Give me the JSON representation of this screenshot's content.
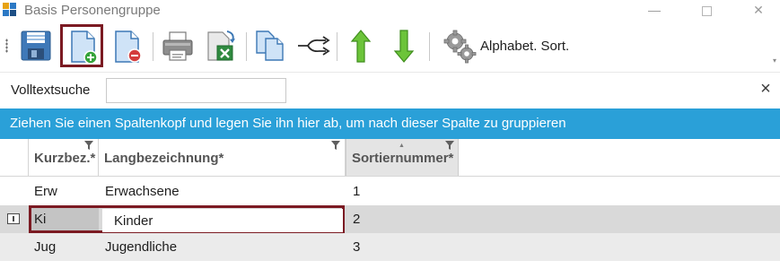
{
  "window": {
    "title": "Basis Personengruppe",
    "minimize_glyph": "—",
    "close_glyph": "✕"
  },
  "toolbar": {
    "buttons": [
      {
        "name": "save",
        "icon": "floppy-disk-icon",
        "active": false
      },
      {
        "name": "new-record",
        "icon": "document-add-icon",
        "active": true
      },
      {
        "name": "delete-record",
        "icon": "document-remove-icon",
        "active": false
      },
      {
        "name": "print",
        "icon": "printer-icon",
        "active": false
      },
      {
        "name": "export-excel",
        "icon": "excel-export-icon",
        "active": false
      },
      {
        "name": "copy",
        "icon": "copy-document-icon",
        "active": false
      },
      {
        "name": "flow",
        "icon": "flow-arrows-icon",
        "active": false
      },
      {
        "name": "move-up",
        "icon": "arrow-up-icon",
        "active": false
      },
      {
        "name": "move-down",
        "icon": "arrow-down-icon",
        "active": false
      }
    ],
    "sort_label": "Alphabet. Sort.",
    "sort_icon": "gears-icon",
    "overflow_glyph": "▾"
  },
  "search": {
    "label": "Volltextsuche",
    "value": "",
    "placeholder": "",
    "clear_glyph": "×"
  },
  "group_panel": {
    "text": "Ziehen Sie einen Spaltenkopf und legen Sie ihn hier ab, um nach dieser Spalte zu gruppieren"
  },
  "grid": {
    "columns": [
      {
        "key": "kurz",
        "label": "Kurzbez.*"
      },
      {
        "key": "lang",
        "label": "Langbezeichnung*"
      },
      {
        "key": "sort",
        "label": "Sortiernummer*",
        "sorted": "ascending"
      }
    ],
    "rows": [
      {
        "kurz": "Erw",
        "lang": "Erwachsene",
        "sort": "1"
      },
      {
        "kurz": "Ki",
        "lang": "Kinder",
        "sort": "2"
      },
      {
        "kurz": "Jug",
        "lang": "Jugendliche",
        "sort": "3"
      }
    ],
    "current_row_index": 1
  },
  "colors": {
    "group_panel_bg": "#2aa0d8",
    "highlight_border": "#7b1a22",
    "selected_row_bg": "#d9d9d9",
    "arrow_green": "#5dbb2e"
  }
}
